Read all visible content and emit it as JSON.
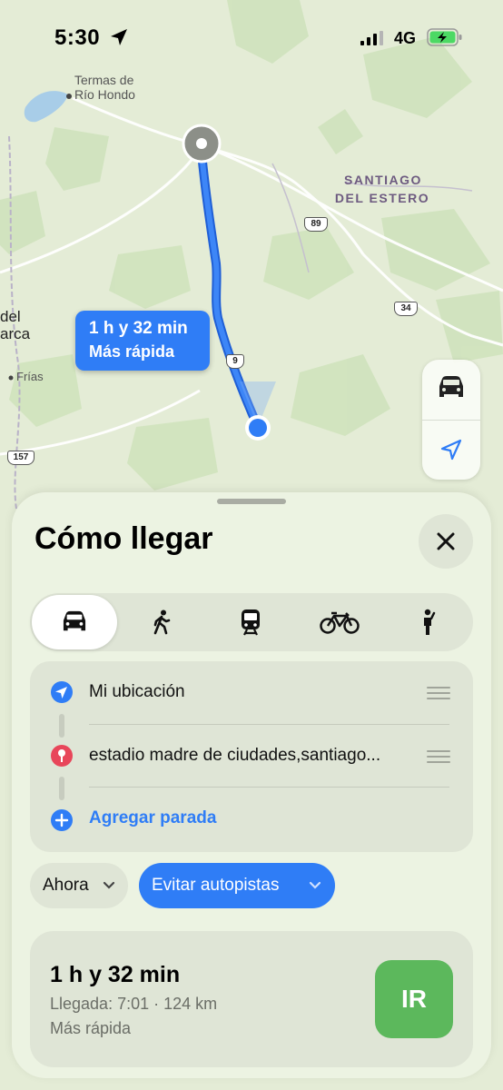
{
  "status_bar": {
    "time": "5:30",
    "network": "4G"
  },
  "map": {
    "labels": {
      "termas": "Termas de",
      "rio_hondo": "Río Hondo",
      "santiago": "SANTIAGO",
      "del_estero": "DEL ESTERO",
      "del": "del",
      "arca": "arca",
      "frias": "Frías"
    },
    "shields": {
      "r89": "89",
      "r34": "34",
      "r9": "9",
      "r157": "157"
    },
    "route_bubble": {
      "duration": "1 h y 32 min",
      "tag": "Más rápida"
    },
    "accent_color": "#2f7df6"
  },
  "sheet": {
    "title": "Cómo llegar",
    "transport_modes": [
      "car-icon",
      "walk-icon",
      "transit-icon",
      "bike-icon",
      "rideshare-icon"
    ],
    "selected_mode": "car",
    "stops": {
      "origin": "Mi ubicación",
      "destination": "estadio madre de ciudades,santiago...",
      "add_stop": "Agregar parada"
    },
    "options": {
      "departure": "Ahora",
      "avoid": "Evitar autopistas"
    },
    "route": {
      "duration": "1 h y 32 min",
      "arrival": "Llegada: 7:01 · 124 km",
      "tag": "Más rápida",
      "go_label": "IR",
      "go_color": "#5cb85c"
    }
  }
}
